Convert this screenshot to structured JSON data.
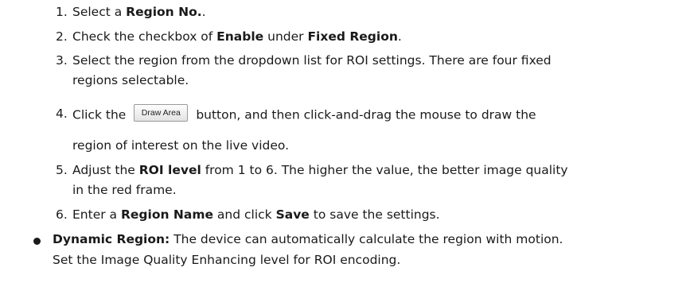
{
  "steps": [
    {
      "num": "1.",
      "pre": "Select a ",
      "bold": "Region No.",
      "post": "."
    },
    {
      "num": "2.",
      "pre": "Check the checkbox of ",
      "bold1": "Enable",
      "mid": " under ",
      "bold2": "Fixed Region",
      "post": "."
    },
    {
      "num": "3.",
      "line1": "Select the region from the dropdown list for ROI settings. There are four fixed",
      "line2": "regions selectable."
    },
    {
      "num": "4.",
      "pre": "Click the",
      "button": "Draw Area",
      "post": "button, and then click-and-drag the mouse to draw the",
      "line2": "region of interest on the live video."
    },
    {
      "num": "5.",
      "pre": "Adjust the ",
      "bold": "ROI level",
      "post": " from 1 to 6. The higher the value, the better image quality",
      "line2": "in the red frame."
    },
    {
      "num": "6.",
      "pre": "Enter a ",
      "bold1": "Region Name",
      "mid": " and click ",
      "bold2": "Save",
      "post": " to save the settings."
    }
  ],
  "bullet": {
    "bold": "Dynamic Region:",
    "line1": " The device can automatically calculate the region with motion.",
    "line2": "Set the Image Quality Enhancing level for ROI encoding."
  }
}
